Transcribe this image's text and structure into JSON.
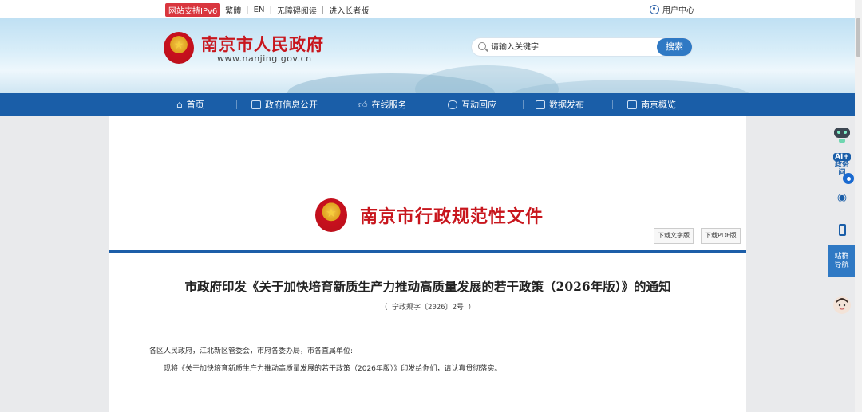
{
  "topbar": {
    "ipv6_badge": "网站支持IPv6",
    "traditional": "繁體",
    "english": "EN",
    "accessible": "无障碍阅读",
    "elderly": "进入长者版",
    "user_center": "用户中心"
  },
  "header": {
    "site_name": "南京市人民政府",
    "site_url": "www.nanjing.gov.cn",
    "search_placeholder": "请输入关键字",
    "search_button": "搜索"
  },
  "nav": {
    "items": [
      {
        "label": "首页",
        "icon": "home-icon"
      },
      {
        "label": "政府信息公开",
        "icon": "document-icon"
      },
      {
        "label": "在线服务",
        "icon": "thumbs-up-icon"
      },
      {
        "label": "互动回应",
        "icon": "chat-icon"
      },
      {
        "label": "数据发布",
        "icon": "monitor-icon"
      },
      {
        "label": "南京概览",
        "icon": "building-icon"
      }
    ]
  },
  "document": {
    "type_title": "南京市行政规范性文件",
    "download_text": "下载文字版",
    "download_pdf": "下载PDF版",
    "title": "市政府印发《关于加快培育新质生产力推动高质量发展的若干政策（2026年版）》的通知",
    "number": "（ 宁政规字〔2026〕2号 ）",
    "salutation": "各区人民政府，江北新区管委会，市府各委办局，市各直属单位:",
    "body": "现将《关于加快培育新质生产力推动高质量发展的若干政策（2026年版）》印发给你们，请认真贯彻落实。"
  },
  "side_tools": {
    "ai_label_1": "AI+",
    "ai_label_2": "政务",
    "ai_label_3": "问",
    "site_nav_1": "站群",
    "site_nav_2": "导航"
  },
  "colors": {
    "nav_blue": "#1a5ea8",
    "title_red": "#c8161d",
    "search_blue": "#2f79c4"
  }
}
